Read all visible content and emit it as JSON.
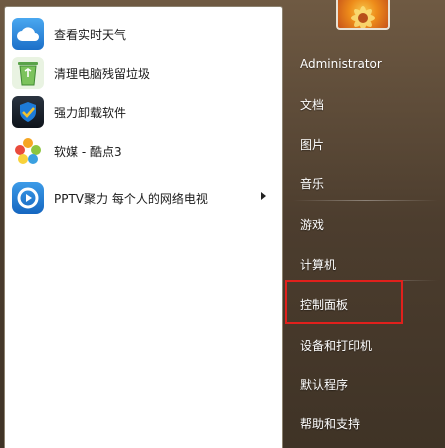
{
  "start_menu": {
    "programs": [
      {
        "label": "查看实时天气",
        "icon": "weather-cloud-icon"
      },
      {
        "label": "清理电脑残留垃圾",
        "icon": "recycle-bin-icon"
      },
      {
        "label": "强力卸载软件",
        "icon": "uninstall-shield-icon"
      },
      {
        "label": "软媒 - 酷点3",
        "icon": "kudian-flower-icon"
      },
      {
        "label": "PPTV聚力 每个人的网络电视",
        "icon": "pptv-icon",
        "has_submenu": true
      }
    ],
    "right_items": {
      "user": "Administrator",
      "documents": "文档",
      "pictures": "图片",
      "music": "音乐",
      "games": "游戏",
      "computer": "计算机",
      "control_panel": "控制面板",
      "devices_printers": "设备和打印机",
      "default_programs": "默认程序",
      "help_support": "帮助和支持"
    },
    "highlight_color": "#e0201c"
  }
}
